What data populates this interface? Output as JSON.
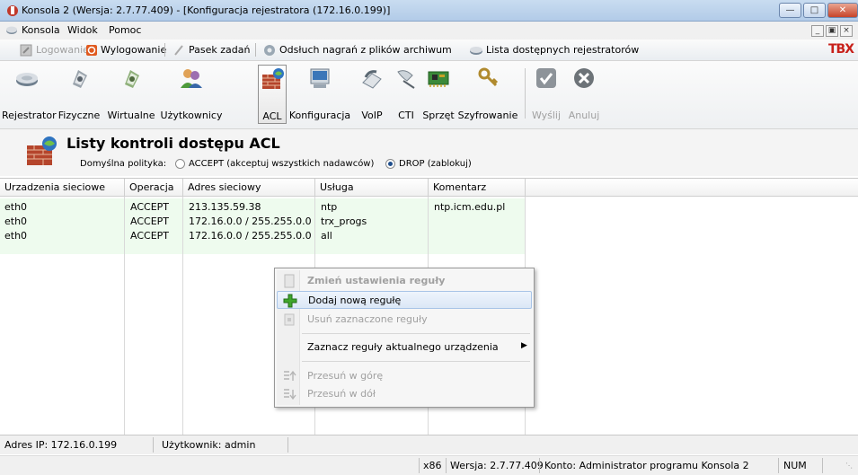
{
  "window": {
    "title": "Konsola 2 (Wersja: 2.7.77.409) - [Konfiguracja rejestratora (172.16.0.199)]"
  },
  "menu": {
    "items": [
      "Konsola",
      "Widok",
      "Pomoc"
    ]
  },
  "quickbar": {
    "login": "Logowanie",
    "logout": "Wylogowanie",
    "taskbar": "Pasek zadań",
    "playback": "Odsłuch nagrań z plików archiwum",
    "recorders": "Lista dostępnych rejestratorów",
    "logo": "TBX"
  },
  "toolbar": {
    "items": [
      {
        "label": "Rejestrator",
        "icon": "recorder-icon"
      },
      {
        "label": "Fizyczne",
        "icon": "physical-channels-icon"
      },
      {
        "label": "Wirtualne",
        "icon": "virtual-channels-icon"
      },
      {
        "label": "Użytkownicy",
        "icon": "users-icon"
      },
      {
        "label": "ACL",
        "icon": "firewall-icon"
      },
      {
        "label": "Konfiguracja",
        "icon": "configuration-icon"
      },
      {
        "label": "VoIP",
        "icon": "voip-icon"
      },
      {
        "label": "CTI",
        "icon": "cti-icon"
      },
      {
        "label": "Sprzęt",
        "icon": "hardware-icon"
      },
      {
        "label": "Szyfrowanie",
        "icon": "encryption-icon"
      },
      {
        "label": "Wyślij",
        "icon": "send-icon"
      },
      {
        "label": "Anuluj",
        "icon": "cancel-icon"
      }
    ]
  },
  "header": {
    "title": "Listy kontroli dostępu ACL",
    "policy_label": "Domyślna polityka:",
    "option_accept": "ACCEPT (akceptuj wszystkich nadawców)",
    "option_drop": "DROP (zablokuj)",
    "selected": "DROP"
  },
  "table": {
    "columns": [
      "Urzadzenia sieciowe",
      "Operacja",
      "Adres sieciowy",
      "Usługa",
      "Komentarz"
    ],
    "rows": [
      [
        "eth0",
        "ACCEPT",
        "213.135.59.38",
        "ntp",
        "ntp.icm.edu.pl"
      ],
      [
        "eth0",
        "ACCEPT",
        "172.16.0.0 / 255.255.0.0",
        "trx_progs",
        ""
      ],
      [
        "eth0",
        "ACCEPT",
        "172.16.0.0 / 255.255.0.0",
        "all",
        ""
      ]
    ]
  },
  "context_menu": {
    "items": [
      {
        "label": "Zmień ustawienia reguły",
        "bold": true,
        "enabled": false
      },
      {
        "label": "Dodaj nową regułę",
        "enabled": true,
        "highlighted": true
      },
      {
        "label": "Usuń zaznaczone reguły",
        "enabled": false
      },
      {
        "label": "Zaznacz reguły aktualnego urządzenia",
        "enabled": true,
        "submenu": true
      },
      {
        "label": "Przesuń w górę",
        "enabled": false
      },
      {
        "label": "Przesuń w dół",
        "enabled": false
      }
    ]
  },
  "status": {
    "ip": "Adres IP: 172.16.0.199",
    "user": "Użytkownik: admin",
    "arch": "x86",
    "version": "Wersja: 2.7.77.409",
    "account": "Konto: Administrator programu Konsola 2",
    "num": "NUM"
  }
}
